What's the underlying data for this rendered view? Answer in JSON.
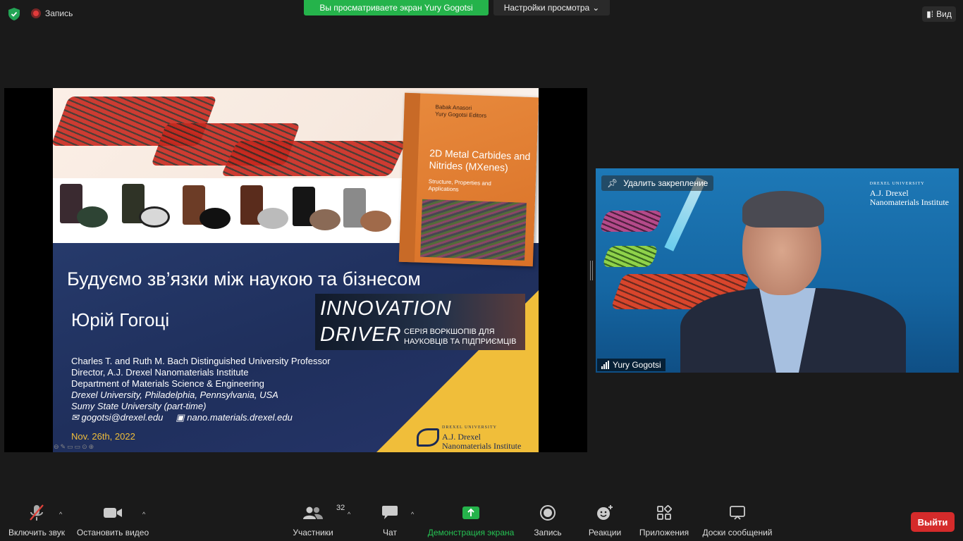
{
  "top": {
    "record_label": "Запись",
    "share_banner": "Вы просматриваете экран Yury Gogotsi",
    "view_options": "Настройки просмотра",
    "view_button": "Вид"
  },
  "slide": {
    "book_editors": [
      "Babak Anasori",
      "Yury Gogotsi  Editors"
    ],
    "book_title": "2D Metal Carbides and Nitrides (MXenes)",
    "book_subtitle": "Structure, Properties and Applications",
    "title": "Будуємо зв’язки між наукою та бізнесом",
    "name": "Юрій Гогоці",
    "innovation_line1": "INNOVATION",
    "innovation_line2": "DRIVER",
    "innovation_sub": [
      "СЕРІЯ ВОРКШОПІВ ДЛЯ",
      "НАУКОВЦІВ ТА ПІДПРИЄМЦІВ"
    ],
    "info": [
      "Charles T. and Ruth M. Bach Distinguished University Professor",
      "Director, A.J. Drexel Nanomaterials Institute",
      "Department of Materials Science & Engineering"
    ],
    "info_italic": [
      "Drexel University, Philadelphia, Pennsylvania, USA",
      "Sumy State University (part-time)"
    ],
    "email": "gogotsi@drexel.edu",
    "website": "nano.materials.drexel.edu",
    "date": "Nov.  26th, 2022",
    "logo_small": "DREXEL UNIVERSITY",
    "logo_line1": "A.J. Drexel",
    "logo_line2": "Nanomaterials Institute"
  },
  "video": {
    "unpin_label": "Удалить закрепление",
    "participant_name": "Yury Gogotsi",
    "logo_small": "DREXEL UNIVERSITY",
    "logo_line1": "A.J. Drexel",
    "logo_line2": "Nanomaterials Institute"
  },
  "toolbar": {
    "mute": "Включить звук",
    "video": "Остановить видео",
    "participants": "Участники",
    "participants_count": "32",
    "chat": "Чат",
    "share": "Демонстрация экрана",
    "record": "Запись",
    "reactions": "Реакции",
    "apps": "Приложения",
    "whiteboards": "Доски сообщений",
    "exit": "Выйти"
  },
  "colors": {
    "share_green": "#25b34b",
    "exit_red": "#d52b2b",
    "slide_yellow": "#f0be3a",
    "slide_navy": "#1f2f5c"
  }
}
